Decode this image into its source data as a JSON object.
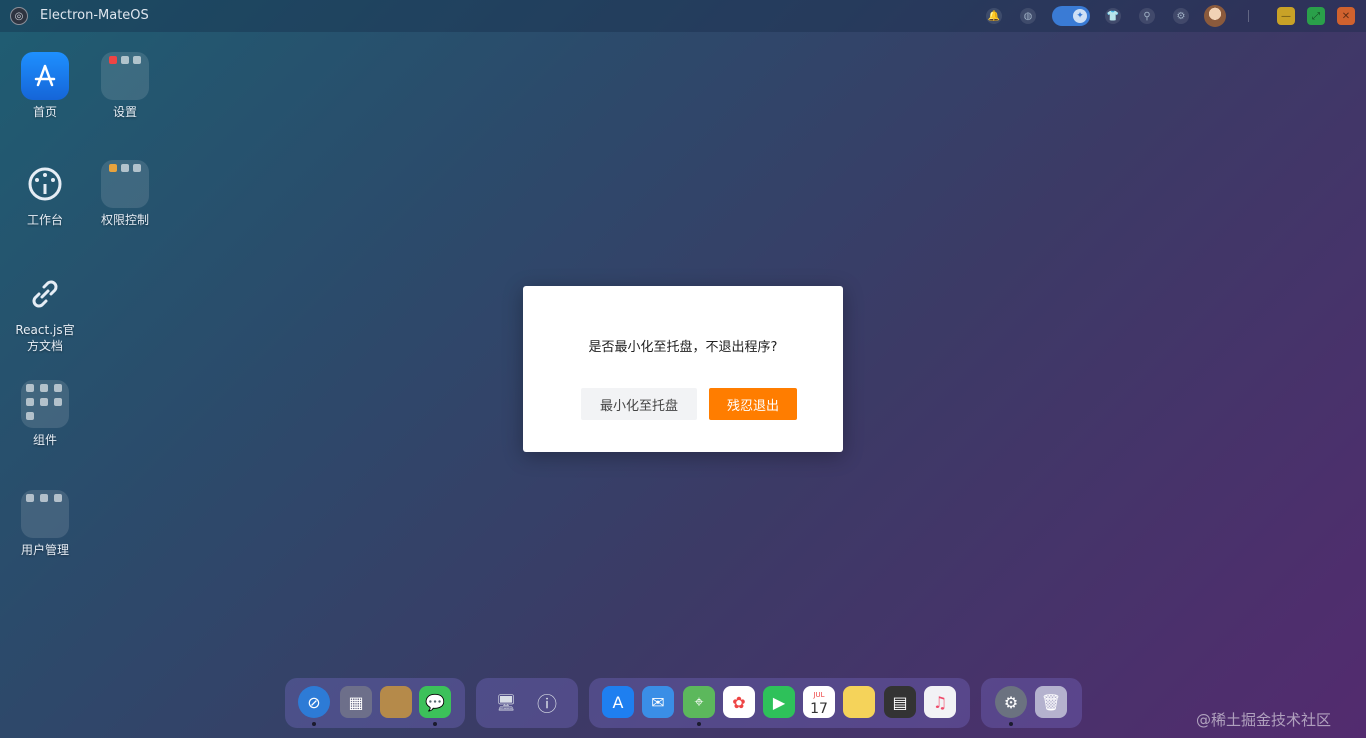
{
  "titlebar": {
    "app_name": "Electron-MateOS",
    "icons": [
      "bell-icon",
      "globe-icon",
      "theme-toggle",
      "shirt-icon",
      "pin-icon",
      "sliders-icon",
      "avatar"
    ],
    "window_controls": [
      "minimize",
      "maximize",
      "close"
    ]
  },
  "desktop": {
    "icons": [
      {
        "label": "首页",
        "icon": "app-store-icon"
      },
      {
        "label": "设置",
        "icon": "folder-icon"
      },
      {
        "label": "工作台",
        "icon": "dashboard-icon"
      },
      {
        "label": "权限控制",
        "icon": "folder-icon"
      },
      {
        "label": "React.js官方文档",
        "icon": "link-icon"
      },
      {
        "label": "组件",
        "icon": "folder-icon"
      },
      {
        "label": "用户管理",
        "icon": "folder-icon"
      }
    ]
  },
  "dialog": {
    "message": "是否最小化至托盘，不退出程序?",
    "minimize_label": "最小化至托盘",
    "quit_label": "残忍退出"
  },
  "dock": {
    "apps": [
      "safari-icon",
      "launchpad-icon",
      "notes-app-icon",
      "messages-icon",
      "monitor-icon",
      "info-icon",
      "app-store-icon",
      "mail-icon",
      "maps-icon",
      "photos-icon",
      "facetime-icon",
      "calendar-icon",
      "notes-icon",
      "calculator-icon",
      "music-icon",
      "system-settings-icon",
      "trash-icon"
    ],
    "calendar_month": "JUL",
    "calendar_day": "17"
  },
  "watermark": "@稀土掘金技术社区",
  "colors": {
    "quit_button": "#ff7d00",
    "minimize_button": "#f2f3f5",
    "toggle": "#3a7bd5"
  }
}
